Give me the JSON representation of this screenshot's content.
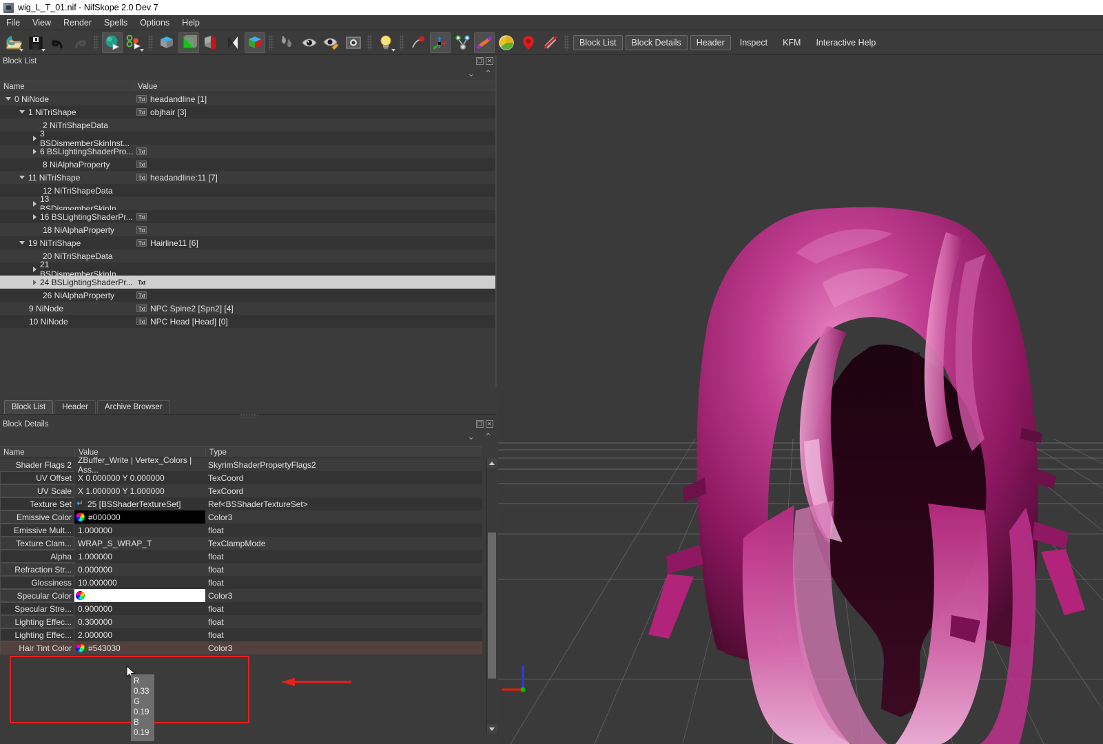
{
  "window": {
    "title": "wig_L_T_01.nif - NifSkope 2.0 Dev 7",
    "icon": "nifskope-app-icon"
  },
  "menubar": {
    "items": [
      "File",
      "View",
      "Render",
      "Spells",
      "Options",
      "Help"
    ]
  },
  "toolbar": {
    "icons": [
      "open-file-icon",
      "save-file-icon",
      "undo-icon",
      "redo-icon",
      "render-sphere-icon",
      "nodes-icon",
      "draw-top-cube-icon",
      "draw-green-cube-icon",
      "draw-red-cube-icon",
      "draw-shadow-icon",
      "draw-rgb-cube-icon",
      "footsteps-icon",
      "eye-icon",
      "eye-edit-icon",
      "camera-icon",
      "lightbulb-icon",
      "pin-icon",
      "axes-icon",
      "nodes-link-icon",
      "bones-icon",
      "pie-color-icon",
      "marker-icon",
      "strikethrough-icon"
    ],
    "panel_buttons": [
      "Block List",
      "Block Details",
      "Header",
      "Inspect",
      "KFM",
      "Interactive Help"
    ],
    "boxed_buttons": [
      "Block List",
      "Block Details",
      "Header"
    ]
  },
  "block_list": {
    "panel_title": "Block List",
    "columns": [
      "Name",
      "Value"
    ],
    "rows": [
      {
        "indent": 0,
        "arrow": "open",
        "name": "0 NiNode",
        "value": "headandline [1]",
        "badge": "Txt"
      },
      {
        "indent": 1,
        "arrow": "open",
        "name": "1 NiTriShape",
        "value": "objhair [3]",
        "badge": "Txt"
      },
      {
        "indent": 2,
        "arrow": "none",
        "name": "2 NiTriShapeData",
        "value": "",
        "badge": ""
      },
      {
        "indent": 2,
        "arrow": "closed",
        "name": "3 BSDismemberSkinInst...",
        "value": "",
        "badge": ""
      },
      {
        "indent": 2,
        "arrow": "closed",
        "name": "6 BSLightingShaderPro...",
        "value": "",
        "badge": "Txt"
      },
      {
        "indent": 2,
        "arrow": "none",
        "name": "8 NiAlphaProperty",
        "value": "",
        "badge": "Txt"
      },
      {
        "indent": 1,
        "arrow": "open",
        "name": "11 NiTriShape",
        "value": "headandline:11 [7]",
        "badge": "Txt"
      },
      {
        "indent": 2,
        "arrow": "none",
        "name": "12 NiTriShapeData",
        "value": "",
        "badge": ""
      },
      {
        "indent": 2,
        "arrow": "closed",
        "name": "13 BSDismemberSkinIn...",
        "value": "",
        "badge": ""
      },
      {
        "indent": 2,
        "arrow": "closed",
        "name": "16 BSLightingShaderPr...",
        "value": "",
        "badge": "Txt"
      },
      {
        "indent": 2,
        "arrow": "none",
        "name": "18 NiAlphaProperty",
        "value": "",
        "badge": "Txt"
      },
      {
        "indent": 1,
        "arrow": "open",
        "name": "19 NiTriShape",
        "value": "Hairline11 [6]",
        "badge": "Txt"
      },
      {
        "indent": 2,
        "arrow": "none",
        "name": "20 NiTriShapeData",
        "value": "",
        "badge": ""
      },
      {
        "indent": 2,
        "arrow": "closed",
        "name": "21 BSDismemberSkinIn...",
        "value": "",
        "badge": ""
      },
      {
        "indent": 2,
        "arrow": "closed",
        "name": "24 BSLightingShaderPr...",
        "value": "",
        "badge": "Txt",
        "selected": true
      },
      {
        "indent": 2,
        "arrow": "none",
        "name": "26 NiAlphaProperty",
        "value": "",
        "badge": "Txt"
      },
      {
        "indent": 1,
        "arrow": "none",
        "name": "9 NiNode",
        "value": "NPC Spine2 [Spn2] [4]",
        "badge": "Txt"
      },
      {
        "indent": 1,
        "arrow": "none",
        "name": "10 NiNode",
        "value": "NPC Head [Head] [0]",
        "badge": "Txt"
      }
    ]
  },
  "dock_tabs": {
    "tabs": [
      "Block List",
      "Header",
      "Archive Browser"
    ],
    "selected": "Block List"
  },
  "block_details": {
    "panel_title": "Block Details",
    "columns": [
      "Name",
      "Value",
      "Type"
    ],
    "rows": [
      {
        "name": "Shader Flags 2",
        "value": "ZBuffer_Write | Vertex_Colors | Ass...",
        "type": "SkyrimShaderPropertyFlags2",
        "kind": "text"
      },
      {
        "name": "UV Offset",
        "value": "X 0.000000 Y 0.000000",
        "type": "TexCoord",
        "kind": "text",
        "name_box": true
      },
      {
        "name": "UV Scale",
        "value": "X 1.000000 Y 1.000000",
        "type": "TexCoord",
        "kind": "text",
        "name_box": true
      },
      {
        "name": "Texture Set",
        "value": "25 [BSShaderTextureSet]",
        "type": "Ref<BSShaderTextureSet>",
        "kind": "ref",
        "name_box": true
      },
      {
        "name": "Emissive Color",
        "value": "#000000",
        "type": "Color3",
        "kind": "color",
        "swatch": "#000000",
        "name_box": true
      },
      {
        "name": "Emissive Mult...",
        "value": "1.000000",
        "type": "float",
        "kind": "text",
        "name_box": true
      },
      {
        "name": "Texture Clam...",
        "value": "WRAP_S_WRAP_T",
        "type": "TexClampMode",
        "kind": "text",
        "name_box": true
      },
      {
        "name": "Alpha",
        "value": "1.000000",
        "type": "float",
        "kind": "text",
        "name_box": true
      },
      {
        "name": "Refraction Str...",
        "value": "0.000000",
        "type": "float",
        "kind": "text",
        "name_box": true
      },
      {
        "name": "Glossiness",
        "value": "10.000000",
        "type": "float",
        "kind": "text",
        "name_box": true
      },
      {
        "name": "Specular Color",
        "value": "",
        "type": "Color3",
        "kind": "color",
        "swatch": "#ffffff",
        "name_box": true
      },
      {
        "name": "Specular Stre...",
        "value": "0.900000",
        "type": "float",
        "kind": "text",
        "name_box": true
      },
      {
        "name": "Lighting Effec...",
        "value": "0.300000",
        "type": "float",
        "kind": "text",
        "name_box": true
      },
      {
        "name": "Lighting Effec...",
        "value": "2.000000",
        "type": "float",
        "kind": "text",
        "name_box": true
      },
      {
        "name": "Hair Tint Color",
        "value": "#543030",
        "type": "Color3",
        "kind": "color",
        "swatch": "#543030",
        "name_box": true,
        "highlighted": true
      }
    ]
  },
  "tooltip": {
    "lines": [
      "R 0.33",
      "G 0.19",
      "B 0.19"
    ]
  },
  "annotations": {
    "highlight_color": "#e8201c",
    "arrow_color": "#e8201c",
    "highlight_target": "Hair Tint Color"
  },
  "viewport": {
    "model": "wig-hair-mesh",
    "hair_color_light": "#e87bbd",
    "hair_color_mid": "#b2237a",
    "hair_color_dark": "#4d0b30",
    "background": "#3a3a3a",
    "grid_color": "#8a8a8a",
    "axes": {
      "x": "#ff1500",
      "y": "#00c000",
      "z": "#2a3ce8"
    }
  },
  "colors": {
    "chrome": "#3b3b3b",
    "row_alt": "#333333",
    "selection": "#cfcfcf",
    "text": "#e2e2e2"
  }
}
